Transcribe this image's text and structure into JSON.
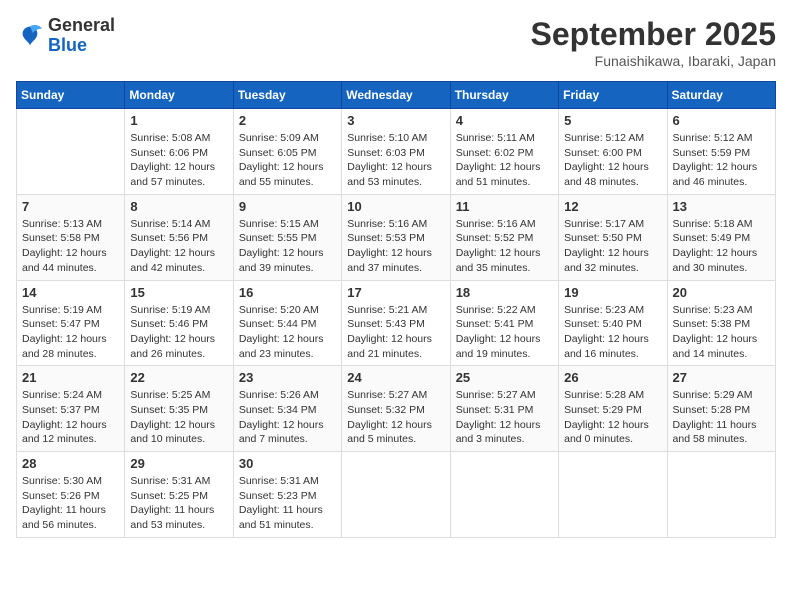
{
  "header": {
    "logo": {
      "line1": "General",
      "line2": "Blue"
    },
    "title": "September 2025",
    "location": "Funaishikawa, Ibaraki, Japan"
  },
  "weekdays": [
    "Sunday",
    "Monday",
    "Tuesday",
    "Wednesday",
    "Thursday",
    "Friday",
    "Saturday"
  ],
  "weeks": [
    [
      {
        "day": "",
        "sunrise": "",
        "sunset": "",
        "daylight": ""
      },
      {
        "day": "1",
        "sunrise": "Sunrise: 5:08 AM",
        "sunset": "Sunset: 6:06 PM",
        "daylight": "Daylight: 12 hours and 57 minutes."
      },
      {
        "day": "2",
        "sunrise": "Sunrise: 5:09 AM",
        "sunset": "Sunset: 6:05 PM",
        "daylight": "Daylight: 12 hours and 55 minutes."
      },
      {
        "day": "3",
        "sunrise": "Sunrise: 5:10 AM",
        "sunset": "Sunset: 6:03 PM",
        "daylight": "Daylight: 12 hours and 53 minutes."
      },
      {
        "day": "4",
        "sunrise": "Sunrise: 5:11 AM",
        "sunset": "Sunset: 6:02 PM",
        "daylight": "Daylight: 12 hours and 51 minutes."
      },
      {
        "day": "5",
        "sunrise": "Sunrise: 5:12 AM",
        "sunset": "Sunset: 6:00 PM",
        "daylight": "Daylight: 12 hours and 48 minutes."
      },
      {
        "day": "6",
        "sunrise": "Sunrise: 5:12 AM",
        "sunset": "Sunset: 5:59 PM",
        "daylight": "Daylight: 12 hours and 46 minutes."
      }
    ],
    [
      {
        "day": "7",
        "sunrise": "Sunrise: 5:13 AM",
        "sunset": "Sunset: 5:58 PM",
        "daylight": "Daylight: 12 hours and 44 minutes."
      },
      {
        "day": "8",
        "sunrise": "Sunrise: 5:14 AM",
        "sunset": "Sunset: 5:56 PM",
        "daylight": "Daylight: 12 hours and 42 minutes."
      },
      {
        "day": "9",
        "sunrise": "Sunrise: 5:15 AM",
        "sunset": "Sunset: 5:55 PM",
        "daylight": "Daylight: 12 hours and 39 minutes."
      },
      {
        "day": "10",
        "sunrise": "Sunrise: 5:16 AM",
        "sunset": "Sunset: 5:53 PM",
        "daylight": "Daylight: 12 hours and 37 minutes."
      },
      {
        "day": "11",
        "sunrise": "Sunrise: 5:16 AM",
        "sunset": "Sunset: 5:52 PM",
        "daylight": "Daylight: 12 hours and 35 minutes."
      },
      {
        "day": "12",
        "sunrise": "Sunrise: 5:17 AM",
        "sunset": "Sunset: 5:50 PM",
        "daylight": "Daylight: 12 hours and 32 minutes."
      },
      {
        "day": "13",
        "sunrise": "Sunrise: 5:18 AM",
        "sunset": "Sunset: 5:49 PM",
        "daylight": "Daylight: 12 hours and 30 minutes."
      }
    ],
    [
      {
        "day": "14",
        "sunrise": "Sunrise: 5:19 AM",
        "sunset": "Sunset: 5:47 PM",
        "daylight": "Daylight: 12 hours and 28 minutes."
      },
      {
        "day": "15",
        "sunrise": "Sunrise: 5:19 AM",
        "sunset": "Sunset: 5:46 PM",
        "daylight": "Daylight: 12 hours and 26 minutes."
      },
      {
        "day": "16",
        "sunrise": "Sunrise: 5:20 AM",
        "sunset": "Sunset: 5:44 PM",
        "daylight": "Daylight: 12 hours and 23 minutes."
      },
      {
        "day": "17",
        "sunrise": "Sunrise: 5:21 AM",
        "sunset": "Sunset: 5:43 PM",
        "daylight": "Daylight: 12 hours and 21 minutes."
      },
      {
        "day": "18",
        "sunrise": "Sunrise: 5:22 AM",
        "sunset": "Sunset: 5:41 PM",
        "daylight": "Daylight: 12 hours and 19 minutes."
      },
      {
        "day": "19",
        "sunrise": "Sunrise: 5:23 AM",
        "sunset": "Sunset: 5:40 PM",
        "daylight": "Daylight: 12 hours and 16 minutes."
      },
      {
        "day": "20",
        "sunrise": "Sunrise: 5:23 AM",
        "sunset": "Sunset: 5:38 PM",
        "daylight": "Daylight: 12 hours and 14 minutes."
      }
    ],
    [
      {
        "day": "21",
        "sunrise": "Sunrise: 5:24 AM",
        "sunset": "Sunset: 5:37 PM",
        "daylight": "Daylight: 12 hours and 12 minutes."
      },
      {
        "day": "22",
        "sunrise": "Sunrise: 5:25 AM",
        "sunset": "Sunset: 5:35 PM",
        "daylight": "Daylight: 12 hours and 10 minutes."
      },
      {
        "day": "23",
        "sunrise": "Sunrise: 5:26 AM",
        "sunset": "Sunset: 5:34 PM",
        "daylight": "Daylight: 12 hours and 7 minutes."
      },
      {
        "day": "24",
        "sunrise": "Sunrise: 5:27 AM",
        "sunset": "Sunset: 5:32 PM",
        "daylight": "Daylight: 12 hours and 5 minutes."
      },
      {
        "day": "25",
        "sunrise": "Sunrise: 5:27 AM",
        "sunset": "Sunset: 5:31 PM",
        "daylight": "Daylight: 12 hours and 3 minutes."
      },
      {
        "day": "26",
        "sunrise": "Sunrise: 5:28 AM",
        "sunset": "Sunset: 5:29 PM",
        "daylight": "Daylight: 12 hours and 0 minutes."
      },
      {
        "day": "27",
        "sunrise": "Sunrise: 5:29 AM",
        "sunset": "Sunset: 5:28 PM",
        "daylight": "Daylight: 11 hours and 58 minutes."
      }
    ],
    [
      {
        "day": "28",
        "sunrise": "Sunrise: 5:30 AM",
        "sunset": "Sunset: 5:26 PM",
        "daylight": "Daylight: 11 hours and 56 minutes."
      },
      {
        "day": "29",
        "sunrise": "Sunrise: 5:31 AM",
        "sunset": "Sunset: 5:25 PM",
        "daylight": "Daylight: 11 hours and 53 minutes."
      },
      {
        "day": "30",
        "sunrise": "Sunrise: 5:31 AM",
        "sunset": "Sunset: 5:23 PM",
        "daylight": "Daylight: 11 hours and 51 minutes."
      },
      {
        "day": "",
        "sunrise": "",
        "sunset": "",
        "daylight": ""
      },
      {
        "day": "",
        "sunrise": "",
        "sunset": "",
        "daylight": ""
      },
      {
        "day": "",
        "sunrise": "",
        "sunset": "",
        "daylight": ""
      },
      {
        "day": "",
        "sunrise": "",
        "sunset": "",
        "daylight": ""
      }
    ]
  ]
}
